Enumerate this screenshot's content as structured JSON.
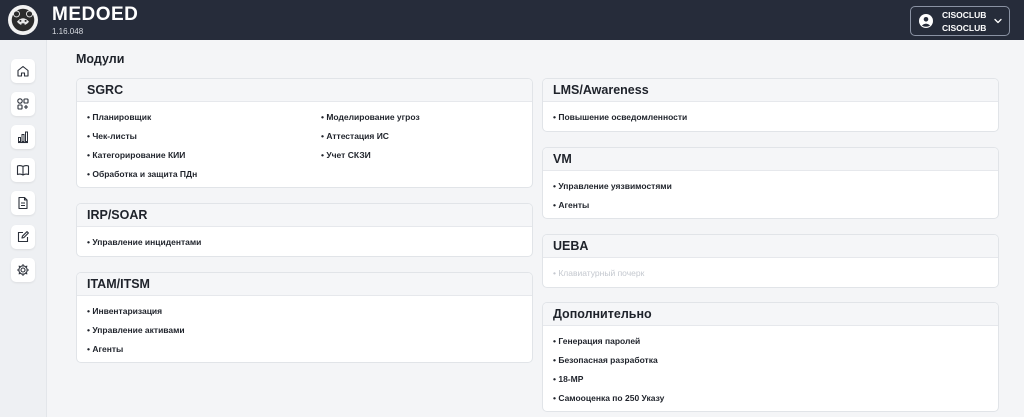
{
  "header": {
    "brand": "MEDOED",
    "version": "1.16.048",
    "user": {
      "name": "CISOCLUB",
      "org": "CISOCLUB"
    }
  },
  "sidebar": {
    "items": [
      {
        "icon": "home-icon"
      },
      {
        "icon": "modules-icon"
      },
      {
        "icon": "chart-icon"
      },
      {
        "icon": "book-icon"
      },
      {
        "icon": "document-icon"
      },
      {
        "icon": "edit-icon"
      },
      {
        "icon": "settings-icon"
      }
    ]
  },
  "page": {
    "title": "Модули"
  },
  "modules": {
    "sgrc": {
      "title": "SGRC",
      "items": [
        "• Планировщик",
        "• Чек-листы",
        "• Категорирование КИИ",
        "• Обработка и защита ПДн",
        "• Моделирование угроз",
        "• Аттестация ИС",
        "• Учет СКЗИ"
      ]
    },
    "irp": {
      "title": "IRP/SOAR",
      "items": [
        "• Управление инцидентами"
      ]
    },
    "itam": {
      "title": "ITAM/ITSM",
      "items": [
        "• Инвентаризация",
        "• Управление активами",
        "• Агенты"
      ]
    },
    "lms": {
      "title": "LMS/Awareness",
      "items": [
        "• Повышение осведомленности"
      ]
    },
    "vm": {
      "title": "VM",
      "items": [
        "• Управление уязвимостями",
        "• Агенты"
      ]
    },
    "ueba": {
      "title": "UEBA",
      "items": [
        "• Клавиатурный почерк"
      ]
    },
    "extra": {
      "title": "Дополнительно",
      "items": [
        "• Генерация паролей",
        "• Безопасная разработка",
        "• 18-МР",
        "• Самооценка по 250 Указу"
      ]
    }
  }
}
